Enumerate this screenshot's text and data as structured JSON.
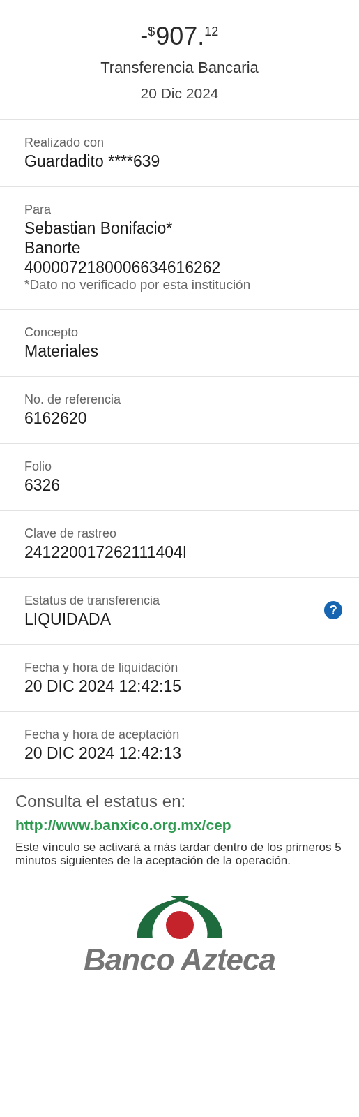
{
  "amount": {
    "sign": "-",
    "currency": "$",
    "integer": "907.",
    "cents": "12"
  },
  "title": "Transferencia Bancaria",
  "date": "20 Dic 2024",
  "details": [
    {
      "label": "Realizado con",
      "values": [
        "Guardadito ****639"
      ]
    },
    {
      "label": "Para",
      "values": [
        "Sebastian Bonifacio*",
        "Banorte",
        "4000072180006634616262"
      ],
      "note": "*Dato no verificado por esta institución"
    },
    {
      "label": "Concepto",
      "values": [
        "Materiales"
      ]
    },
    {
      "label": "No. de referencia",
      "values": [
        "6162620"
      ]
    },
    {
      "label": "Folio",
      "values": [
        "6326"
      ]
    },
    {
      "label": "Clave de rastreo",
      "values": [
        "241220017262111404I"
      ]
    },
    {
      "label": "Estatus de transferencia",
      "values": [
        "LIQUIDADA"
      ],
      "help": "?"
    },
    {
      "label": "Fecha y hora de liquidación",
      "values": [
        "20 DIC 2024 12:42:15"
      ]
    },
    {
      "label": "Fecha y hora de aceptación",
      "values": [
        "20 DIC 2024 12:42:13"
      ]
    }
  ],
  "footer": {
    "heading": "Consulta el estatus en:",
    "link": "http://www.banxico.org.mx/cep",
    "note": "Este vínculo se activará a más tardar dentro de los primeros 5 minutos siguientes de la aceptación de la operación."
  },
  "logo": {
    "text": "Banco Azteca"
  }
}
